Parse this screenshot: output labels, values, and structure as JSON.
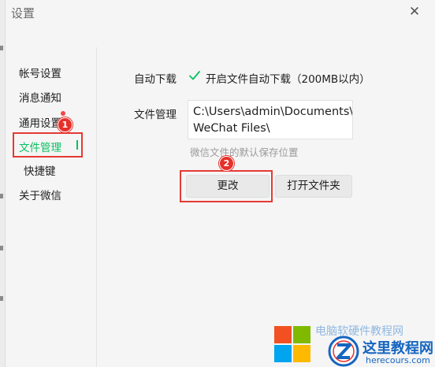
{
  "window": {
    "title": "设置",
    "close_glyph": "✕"
  },
  "sidebar": {
    "items": [
      {
        "label": "帐号设置"
      },
      {
        "label": "消息通知"
      },
      {
        "label": "通用设置"
      },
      {
        "label": "文件管理"
      },
      {
        "label": "快捷键"
      },
      {
        "label": "关于微信"
      }
    ],
    "active_index": 3,
    "notification_dot_on": "通用设置"
  },
  "file_settings": {
    "auto_download": {
      "label": "自动下载",
      "checkbox_checked": true,
      "checkbox_label": "开启文件自动下载（200MB以内）"
    },
    "file_management": {
      "label": "文件管理",
      "path_line1": "C:\\Users\\admin\\Documents\\",
      "path_line2": "WeChat Files\\",
      "hint": "微信文件的默认保存位置"
    },
    "buttons": {
      "change": "更改",
      "open_folder": "打开文件夹"
    }
  },
  "callouts": {
    "step1": "1",
    "step2": "2"
  },
  "watermark": {
    "faded_text": "电脑软硬件教程网",
    "title": "这里教程网",
    "url": "herecours.com"
  },
  "colors": {
    "accent_green": "#07c160",
    "callout_red": "#e5312b",
    "watermark_blue": "#1565c0"
  }
}
